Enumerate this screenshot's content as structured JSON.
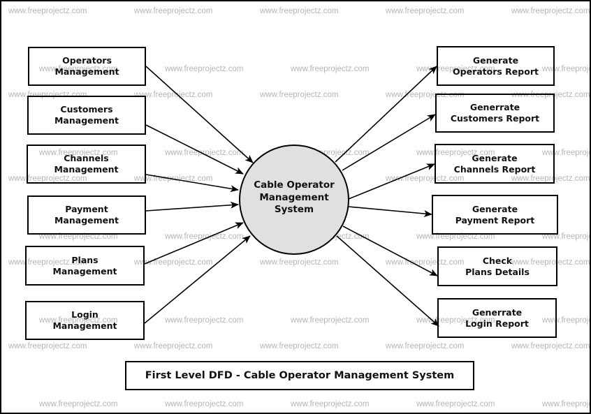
{
  "diagram": {
    "title": "First Level DFD - Cable Operator Management System",
    "center_process": "Cable Operator\nManagement\nSystem",
    "inputs": [
      "Operators\nManagement",
      "Customers\nManagement",
      "Channels\nManagement",
      "Payment\nManagement",
      "Plans\nManagement",
      "Login\nManagement"
    ],
    "outputs": [
      "Generate\nOperators Report",
      "Generrate\nCustomers Report",
      "Generate\nChannels Report",
      "Generate\nPayment Report",
      "Check\nPlans Details",
      "Generrate\nLogin Report"
    ],
    "watermark": "www.freeprojectz.com",
    "colors": {
      "process_fill": "#e0e0e0",
      "stroke": "#000000",
      "watermark": "#b5b5b5"
    }
  }
}
